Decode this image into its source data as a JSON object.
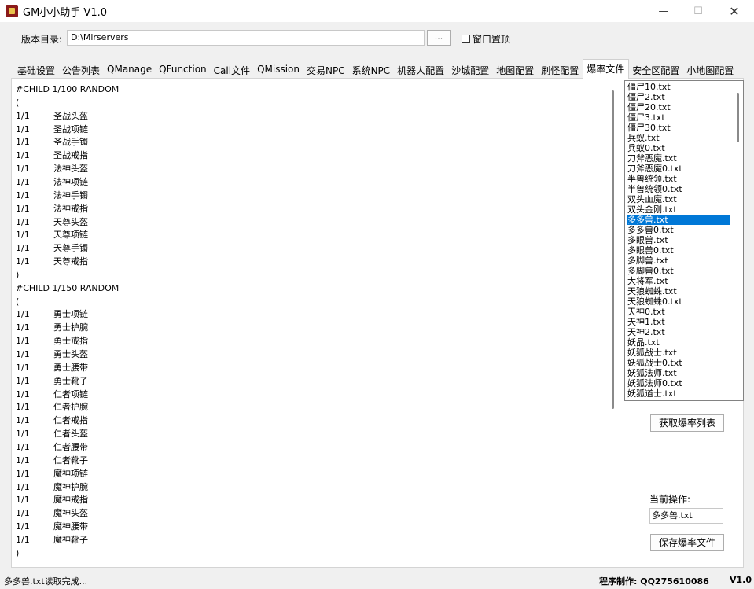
{
  "window": {
    "title": "GM小小助手  V1.0",
    "min_glyph": "—",
    "max_glyph": "☐",
    "close_glyph": "✕"
  },
  "toolbar": {
    "dir_label": "版本目录:",
    "dir_value": "D:\\Mirservers",
    "browse_label": "...",
    "topmost_label": "窗口置顶"
  },
  "tabs": [
    "基础设置",
    "公告列表",
    "QManage",
    "QFunction",
    "Call文件",
    "QMission",
    "交易NPC",
    "系统NPC",
    "机器人配置",
    "沙城配置",
    "地图配置",
    "刷怪配置",
    "爆率文件",
    "安全区配置",
    "小地图配置"
  ],
  "active_tab": 12,
  "editor": {
    "lines": [
      {
        "q": "#CHILD 1/100 RANDOM",
        "n": ""
      },
      {
        "q": "(",
        "n": ""
      },
      {
        "q": "1/1",
        "n": "圣战头盔"
      },
      {
        "q": "1/1",
        "n": "圣战项链"
      },
      {
        "q": "1/1",
        "n": "圣战手镯"
      },
      {
        "q": "1/1",
        "n": "圣战戒指"
      },
      {
        "q": "1/1",
        "n": "法神头盔"
      },
      {
        "q": "1/1",
        "n": "法神项链"
      },
      {
        "q": "1/1",
        "n": "法神手镯"
      },
      {
        "q": "1/1",
        "n": "法神戒指"
      },
      {
        "q": "1/1",
        "n": "天尊头盔"
      },
      {
        "q": "1/1",
        "n": "天尊项链"
      },
      {
        "q": "1/1",
        "n": "天尊手镯"
      },
      {
        "q": "1/1",
        "n": "天尊戒指"
      },
      {
        "q": ")",
        "n": ""
      },
      {
        "q": "#CHILD 1/150 RANDOM",
        "n": ""
      },
      {
        "q": "(",
        "n": ""
      },
      {
        "q": "1/1",
        "n": "勇士项链"
      },
      {
        "q": "1/1",
        "n": "勇士护腕"
      },
      {
        "q": "1/1",
        "n": "勇士戒指"
      },
      {
        "q": "1/1",
        "n": "勇士头盔"
      },
      {
        "q": "1/1",
        "n": "勇士腰带"
      },
      {
        "q": "1/1",
        "n": "勇士靴子"
      },
      {
        "q": "1/1",
        "n": "仁者项链"
      },
      {
        "q": "1/1",
        "n": "仁者护腕"
      },
      {
        "q": "1/1",
        "n": "仁者戒指"
      },
      {
        "q": "1/1",
        "n": "仁者头盔"
      },
      {
        "q": "1/1",
        "n": "仁者腰带"
      },
      {
        "q": "1/1",
        "n": "仁者靴子"
      },
      {
        "q": "1/1",
        "n": "魔神项链"
      },
      {
        "q": "1/1",
        "n": "魔神护腕"
      },
      {
        "q": "1/1",
        "n": "魔神戒指"
      },
      {
        "q": "1/1",
        "n": "魔神头盔"
      },
      {
        "q": "1/1",
        "n": "魔神腰带"
      },
      {
        "q": "1/1",
        "n": "魔神靴子"
      },
      {
        "q": ")",
        "n": ""
      }
    ]
  },
  "files": [
    "僵尸10.txt",
    "僵尸2.txt",
    "僵尸20.txt",
    "僵尸3.txt",
    "僵尸30.txt",
    "兵蚁.txt",
    "兵蚁0.txt",
    "刀斧恶魔.txt",
    "刀斧恶魔0.txt",
    "半兽统领.txt",
    "半兽统领0.txt",
    "双头血魔.txt",
    "双头金刚.txt",
    "多多兽.txt",
    "多多兽0.txt",
    "多眼兽.txt",
    "多眼兽0.txt",
    "多脚兽.txt",
    "多脚兽0.txt",
    "大将军.txt",
    "天狼蜘蛛.txt",
    "天狼蜘蛛0.txt",
    "天神0.txt",
    "天神1.txt",
    "天神2.txt",
    "妖晶.txt",
    "妖狐战士.txt",
    "妖狐战士0.txt",
    "妖狐法师.txt",
    "妖狐法师0.txt",
    "妖狐道士.txt"
  ],
  "selected_file": 13,
  "side": {
    "get_list_label": "获取爆率列表",
    "current_label": "当前操作:",
    "current_value": "多多兽.txt",
    "save_label": "保存爆率文件"
  },
  "status": {
    "message": "多多兽.txt读取完成...",
    "maker": "程序制作:  QQ275610086",
    "version": "V1.0"
  }
}
